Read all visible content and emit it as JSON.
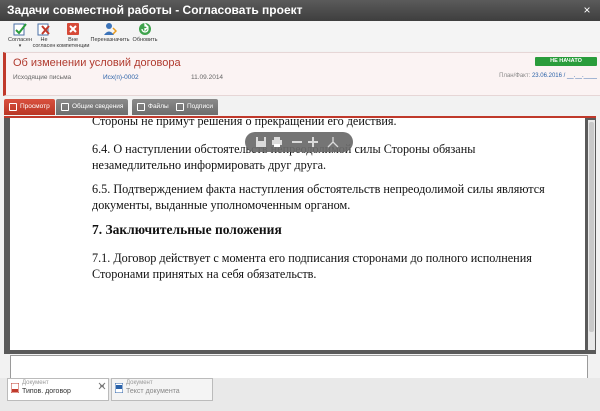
{
  "window": {
    "title": "Задачи совместной работы - Согласовать проект",
    "close_glyph": "×"
  },
  "toolbar": {
    "buttons": [
      {
        "label": "Согласен",
        "icon": "approve-icon",
        "caret": "▾"
      },
      {
        "label": "Не согласен",
        "icon": "disagree-icon"
      },
      {
        "label": "Вне компетенции",
        "icon": "out-of-competence-icon"
      },
      {
        "label": "Переназначить",
        "icon": "reassign-icon"
      },
      {
        "label": "Обновить",
        "icon": "refresh-icon"
      }
    ]
  },
  "document": {
    "title": "Об изменении условий договора",
    "category": "Исходящие письма",
    "number": "Исх(п)-0002",
    "date": "11.09.2014",
    "status": "НЕ НАЧАТО",
    "planfact_label": "План/Факт:",
    "planfact_value": "23.06.2016 / __.__.____"
  },
  "tabs": [
    {
      "label": "Просмотр",
      "active": true
    },
    {
      "label": "Общие сведения",
      "active": false
    },
    {
      "label": "Файлы",
      "active": false
    },
    {
      "label": "Подписи",
      "active": false
    }
  ],
  "content": {
    "p0": "Стороны не примут решения о прекращении его действия.",
    "p1": "6.4. О наступлении обстоятельств непреодолимой силы Стороны обязаны незамедлительно информировать друг друга.",
    "p2": "6.5. Подтверждением факта наступления обстоятельств непреодолимой силы являются документы, выданные уполномоченным органом.",
    "h7": "7. Заключительные положения",
    "p3": "7.1. Договор действует с момента его подписания сторонами до полного исполнения Сторонами принятых на себя обязательств."
  },
  "pdf_toolbar": {
    "icons": [
      "save-icon",
      "print-icon",
      "zoom-out-icon",
      "zoom-in-icon",
      "fit-icon"
    ]
  },
  "bottom_tabs": [
    {
      "caption": "Документ",
      "name": "Типов. договор",
      "active": true
    },
    {
      "caption": "Документ",
      "name": "Текст документа",
      "active": false
    }
  ],
  "colors": {
    "accent": "#c0392b",
    "status": "#2a9c3b",
    "link": "#2b62a8"
  }
}
